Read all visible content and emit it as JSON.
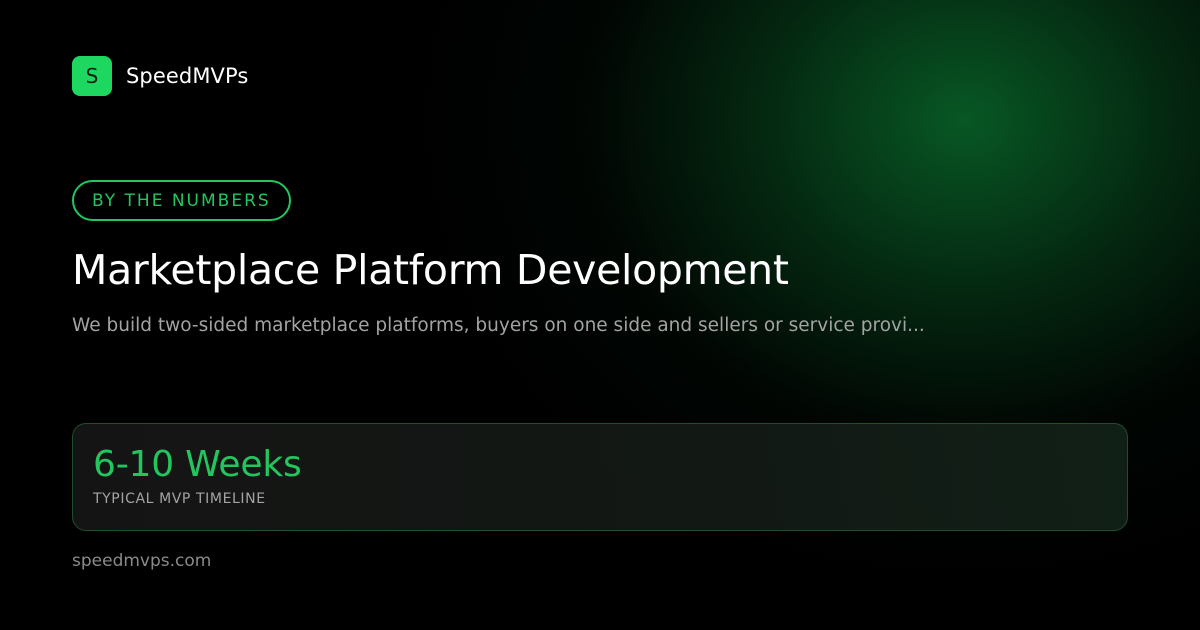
{
  "brand": {
    "logo_letter": "S",
    "name": "SpeedMVPs"
  },
  "badge": {
    "label": "BY THE NUMBERS"
  },
  "title": "Marketplace Platform Development",
  "subtitle": "We build two-sided marketplace platforms, buyers on one side and sellers or service provi...",
  "stat": {
    "value": "6-10 Weeks",
    "label": "TYPICAL MVP TIMELINE"
  },
  "footer": {
    "url": "speedmvps.com"
  },
  "colors": {
    "accent": "#22c55e",
    "logo_bg": "#1ed760",
    "background": "#000000",
    "glow": "#085c26",
    "muted_text": "#a3a3a3"
  }
}
